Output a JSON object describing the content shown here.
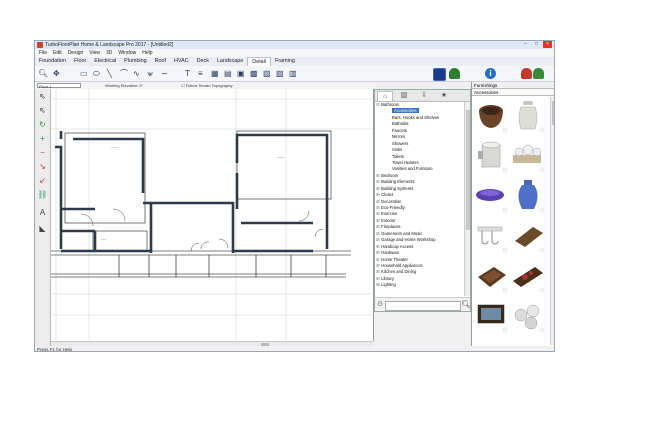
{
  "window": {
    "title": "TurboFloorPlan Home & Landscape Pro 2017 - [Untitled2]",
    "buttons": [
      "–",
      "□",
      "×"
    ]
  },
  "menu": [
    "File",
    "Edit",
    "Design",
    "View",
    "3D",
    "Window",
    "Help"
  ],
  "tabs": [
    "Foundation",
    "Floor",
    "Electrical",
    "Plumbing",
    "Roof",
    "HVAC",
    "Deck",
    "Landscape",
    "Detail",
    "Framing"
  ],
  "active_tab": "Detail",
  "toolbar_icons": [
    "zoom-icon",
    "pan-icon",
    "rectangle-icon",
    "ellipse-icon",
    "line-icon",
    "arc-icon",
    "spline-icon",
    "curve-icon",
    "wave-icon"
  ],
  "options": {
    "floor_select": "Floor 1",
    "working_elevation_label": "Working Elevation:",
    "working_elevation_value": "0\"",
    "follow_terrain_label": "Follow Terrain Topography"
  },
  "status": "Press F1 for Help",
  "catalog": {
    "tab_icons": [
      "furniture-icon",
      "materials-icon",
      "import-icon",
      "favorites-icon"
    ],
    "tree": [
      {
        "label": "Bathroom",
        "expanded": true,
        "children": [
          "Accessories",
          "Bars, Hooks and Shelves",
          "Bathtubs",
          "Faucets",
          "Mirrors",
          "Showers",
          "Sinks",
          "Toilets",
          "Towel Heaters",
          "Vanities and Furniture"
        ]
      },
      {
        "label": "Bedroom"
      },
      {
        "label": "Building Elements"
      },
      {
        "label": "Building Systems"
      },
      {
        "label": "Closet"
      },
      {
        "label": "Decoration"
      },
      {
        "label": "Eco-Friendly"
      },
      {
        "label": "Exercise"
      },
      {
        "label": "Exterior"
      },
      {
        "label": "Fireplaces"
      },
      {
        "label": "Gameroom and Music"
      },
      {
        "label": "Garage and Home Workshop"
      },
      {
        "label": "Handicap Access"
      },
      {
        "label": "Hardware"
      },
      {
        "label": "Home Theater"
      },
      {
        "label": "Household Appliances"
      },
      {
        "label": "Kitchen and Dining"
      },
      {
        "label": "Library"
      },
      {
        "label": "Lighting"
      }
    ],
    "selected": "Accessories"
  },
  "right_panel": {
    "dropdown": "Furnishings",
    "category": "Accessories",
    "items": [
      "wooden-bowl",
      "ceramic-vase",
      "cylinder-container",
      "tea-set",
      "purple-glass-dish",
      "blue-vase",
      "wall-hooks",
      "wooden-tray",
      "brown-dish",
      "decorative-tray",
      "glass-tray",
      "towel-rolls"
    ]
  }
}
